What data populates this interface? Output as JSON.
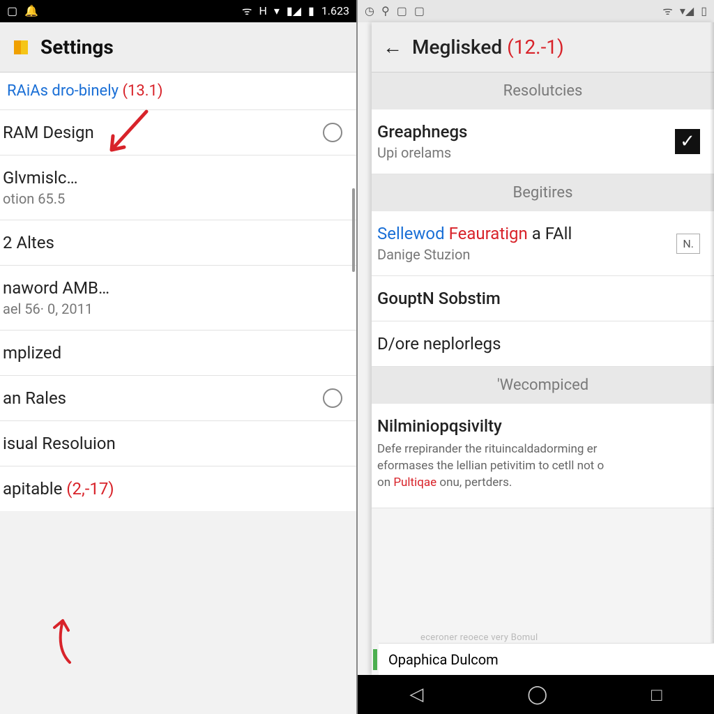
{
  "left": {
    "status": {
      "clock": "1.623"
    },
    "title": "Settings",
    "link_row": {
      "text": "RAiAs dro-binely",
      "annot": "(13.1)"
    },
    "items": [
      {
        "title": "RAM Design",
        "radio": true
      },
      {
        "title": "Glvmislc…",
        "sub": "otion 65.5"
      },
      {
        "title": "2 Altes"
      },
      {
        "title": "naword AMB…",
        "sub": "ael 56· 0, 2011"
      },
      {
        "title": "mplized"
      },
      {
        "title": "an Rales",
        "radio": true
      },
      {
        "title": "isual Resoluion"
      },
      {
        "title": "apitable",
        "annot": "(2,-17)"
      }
    ]
  },
  "right": {
    "title": "Meglisked",
    "title_annot": "(12.-1)",
    "sections": {
      "s1": {
        "header": "Resolutcies",
        "item": {
          "title": "Greaphnegs",
          "sub": "Upi orelams",
          "check": true
        }
      },
      "s2": {
        "header": "Begitires",
        "item1": {
          "pre": "Sellewod",
          "mid": "Feauratign",
          "post": "a FAll",
          "sub": "Danige Stuzion",
          "btn": "N."
        },
        "item2": {
          "title": "GouptN Sobstim"
        },
        "item3": {
          "title": "D/ore neplorlegs"
        }
      },
      "s3": {
        "header": "'Wecompiced",
        "item": {
          "title": "Nilminiopqsivilty",
          "desc1": "Defe rrepirander the rituincaldadorming er",
          "desc2": "eformases the lellian petivitim to cetll not o",
          "desc3_pre": "on ",
          "desc3_hl": "Pultiqae",
          "desc3_post": " onu, pertders."
        }
      }
    },
    "bottom_row": "Opaphica Dulcom",
    "bottom_caption": "eceroner reoece very Bomul"
  }
}
